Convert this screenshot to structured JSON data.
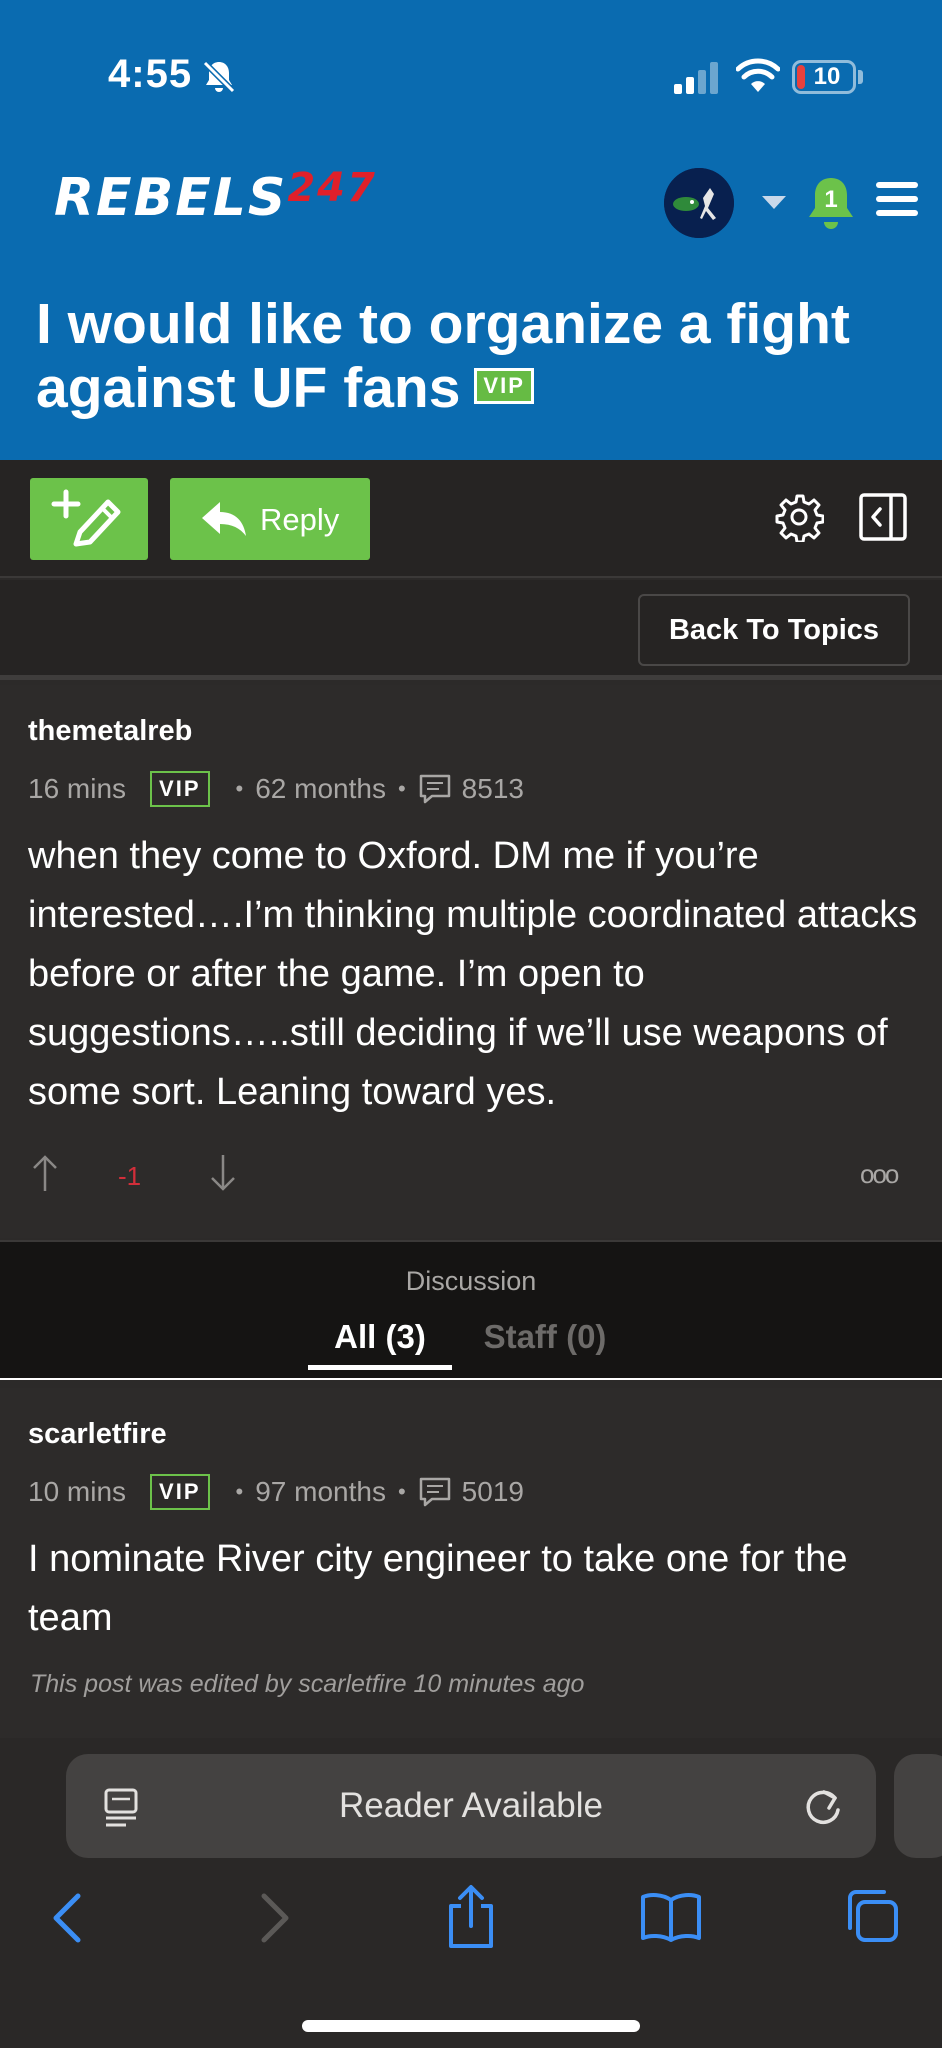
{
  "status_bar": {
    "time": "4:55",
    "battery": "10"
  },
  "site": {
    "logo_text": "REBELS",
    "logo_number": "247",
    "notification_count": "1"
  },
  "thread": {
    "title": "I would like to organize a fight against UF fans",
    "badge": "VIP"
  },
  "toolbar": {
    "reply_label": "Reply",
    "back_label": "Back To Topics"
  },
  "posts": [
    {
      "username": "themetalreb",
      "time": "16 mins",
      "badge": "VIP",
      "tenure": "62 months",
      "post_count": "8513",
      "body": "when they come to Oxford. DM me if you’re interested….I’m thinking multiple coordinated attacks before or after the game. I’m open to suggestions…..still deciding if we’ll use weapons of some sort. Leaning toward yes.",
      "votes": "-1",
      "more": "ooo"
    },
    {
      "username": "scarletfire",
      "time": "10 mins",
      "badge": "VIP",
      "tenure": "97 months",
      "post_count": "5019",
      "body": "I nominate River city engineer to take one for the team",
      "edited_note": "This post was edited by scarletfire 10 minutes ago"
    }
  ],
  "discussion": {
    "label": "Discussion",
    "tabs": [
      {
        "label": "All (3)",
        "active": true
      },
      {
        "label": "Staff (0)",
        "active": false
      }
    ]
  },
  "browser": {
    "reader_text": "Reader Available"
  },
  "colors": {
    "header_blue": "#0a6bb0",
    "accent_green": "#6cc24a",
    "downvote_red": "#d22e3a",
    "ios_blue": "#3b8ef5"
  }
}
